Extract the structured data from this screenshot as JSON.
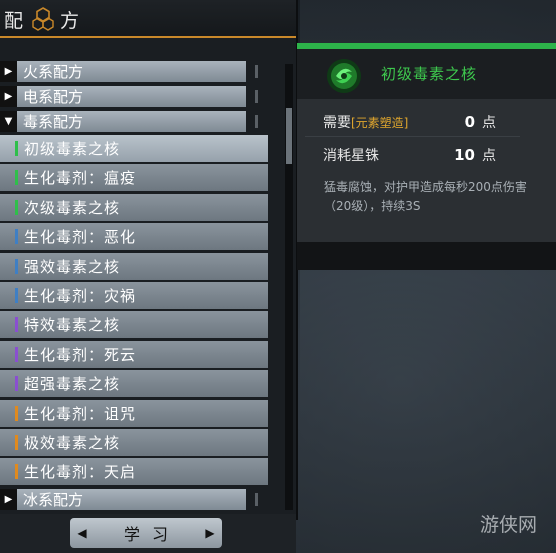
{
  "title": {
    "char1": "配",
    "char2": "方"
  },
  "categories": {
    "fire": "火系配方",
    "electric": "电系配方",
    "poison": "毒系配方",
    "ice": "冰系配方"
  },
  "items": [
    {
      "label": "初级毒素之核",
      "color": "#2fbf4a",
      "selected": true
    },
    {
      "label": "生化毒剂：瘟疫",
      "color": "#2fbf4a",
      "selected": false
    },
    {
      "label": "次级毒素之核",
      "color": "#2fbf4a",
      "selected": false
    },
    {
      "label": "生化毒剂：恶化",
      "color": "#3f7fc4",
      "selected": false
    },
    {
      "label": "强效毒素之核",
      "color": "#3f7fc4",
      "selected": false
    },
    {
      "label": "生化毒剂：灾祸",
      "color": "#3f7fc4",
      "selected": false
    },
    {
      "label": "特效毒素之核",
      "color": "#8a4fd0",
      "selected": false
    },
    {
      "label": "生化毒剂：死云",
      "color": "#8a4fd0",
      "selected": false
    },
    {
      "label": "超强毒素之核",
      "color": "#8a4fd0",
      "selected": false
    },
    {
      "label": "生化毒剂：诅咒",
      "color": "#e08a1e",
      "selected": false
    },
    {
      "label": "极效毒素之核",
      "color": "#e08a1e",
      "selected": false
    },
    {
      "label": "生化毒剂：天启",
      "color": "#e08a1e",
      "selected": false
    }
  ],
  "learn_button": {
    "label": "学习"
  },
  "detail": {
    "title": "初级毒素之核",
    "req1": {
      "label": "需要",
      "tag": "[元素塑造]",
      "value": "0",
      "unit": "点"
    },
    "req2": {
      "label": "消耗星铢",
      "value": "10",
      "unit": "点"
    },
    "description": "猛毒腐蚀，对护甲造成每秒200点伤害（20级），持续3S"
  },
  "watermark": "游侠网",
  "colors": {
    "accent_orange": "#c9882a",
    "accent_green": "#2db34a"
  }
}
